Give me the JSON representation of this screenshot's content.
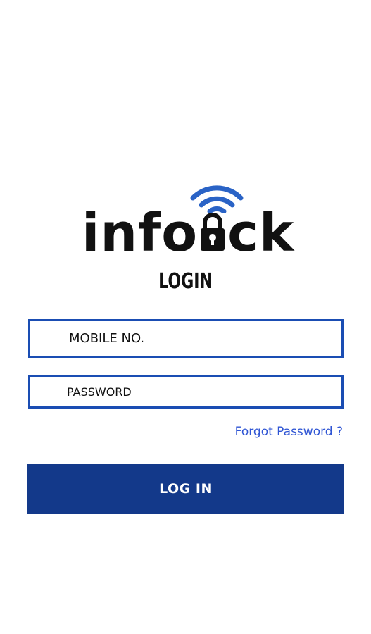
{
  "brand": {
    "logo_text_prefix": "info",
    "logo_text_suffix": "ck",
    "logo_lock_letter": "o",
    "accent_color": "#1a4db3",
    "wifi_color": "#2a63c6",
    "logo_icon": "wifi-icon",
    "lock_icon": "padlock-icon"
  },
  "page": {
    "title": "LOGIN"
  },
  "form": {
    "mobile_placeholder": "MOBILE NO.",
    "password_placeholder": "PASSWORD",
    "forgot_label": "Forgot Password ?",
    "submit_label": "LOG IN",
    "submit_color": "#13398a",
    "link_color": "#2f55d4"
  }
}
